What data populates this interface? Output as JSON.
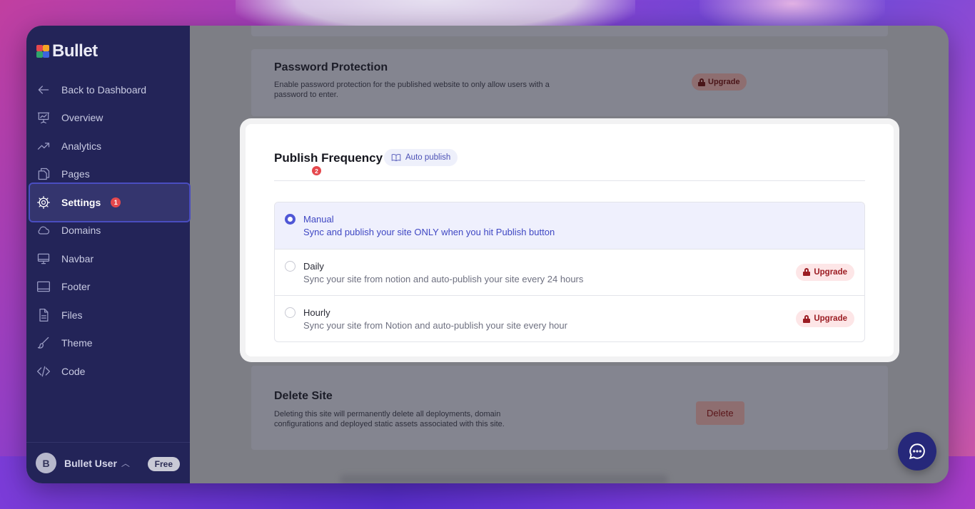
{
  "app": {
    "logo_text": "Bullet",
    "logo_colors": [
      "#e5484d",
      "#f5a524",
      "#30a46c",
      "#3e63dd"
    ]
  },
  "sidebar": {
    "items": [
      {
        "label": "Back to Dashboard",
        "icon": "arrow-left-icon"
      },
      {
        "label": "Overview",
        "icon": "presentation-chart-icon"
      },
      {
        "label": "Analytics",
        "icon": "trending-up-icon"
      },
      {
        "label": "Pages",
        "icon": "copy-pages-icon"
      },
      {
        "label": "Settings",
        "icon": "gear-icon",
        "active": true,
        "badge": "1"
      },
      {
        "label": "Domains",
        "icon": "cloud-icon"
      },
      {
        "label": "Navbar",
        "icon": "monitor-icon"
      },
      {
        "label": "Footer",
        "icon": "layout-footer-icon"
      },
      {
        "label": "Files",
        "icon": "file-icon"
      },
      {
        "label": "Theme",
        "icon": "paintbrush-icon"
      },
      {
        "label": "Code",
        "icon": "code-icon"
      }
    ],
    "user": {
      "initial": "B",
      "name": "Bullet User",
      "plan": "Free"
    }
  },
  "main": {
    "password_protection": {
      "title": "Password Protection",
      "description": "Enable password protection for the published website to only allow users with a password to enter.",
      "upgrade_label": "Upgrade"
    },
    "publish_frequency": {
      "title": "Publish Frequency",
      "tag_label": "Auto publish",
      "badge": "2",
      "options": [
        {
          "label": "Manual",
          "description": "Sync and publish your site ONLY when you hit Publish button",
          "selected": true
        },
        {
          "label": "Daily",
          "description": "Sync your site from notion and auto-publish your site every 24 hours",
          "upgrade_label": "Upgrade"
        },
        {
          "label": "Hourly",
          "description": "Sync your site from Notion and auto-publish your site every hour",
          "upgrade_label": "Upgrade"
        }
      ]
    },
    "delete_site": {
      "title": "Delete Site",
      "description": "Deleting this site will permanently delete all deployments, domain configurations and deployed static assets associated with this site.",
      "button_label": "Delete"
    }
  },
  "colors": {
    "sidebar_bg": "#232458",
    "accent": "#4f57d6",
    "danger": "#e5484d"
  }
}
